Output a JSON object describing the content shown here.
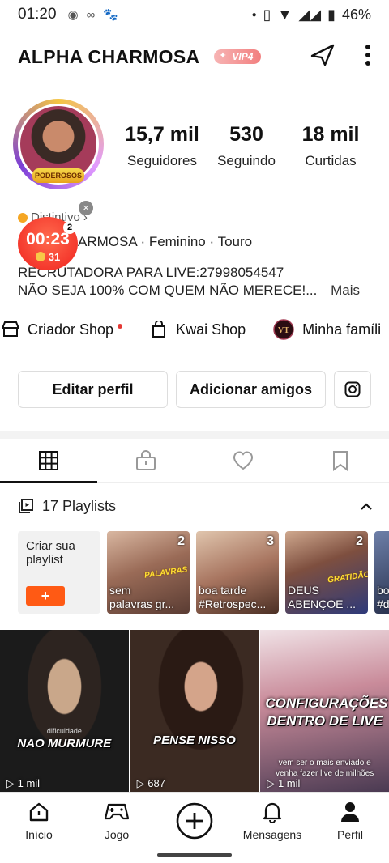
{
  "status_bar": {
    "time": "01:20",
    "battery": "46%"
  },
  "profile": {
    "username": "ALPHA CHARMOSA",
    "vip_badge": "VIP4",
    "avatar_label": "PODEROSOS",
    "stats": [
      {
        "value": "15,7 mil",
        "label": "Seguidores"
      },
      {
        "value": "530",
        "label": "Seguindo"
      },
      {
        "value": "18 mil",
        "label": "Curtidas"
      }
    ],
    "badge_text": "Distintivo",
    "meta_line": "ARMOSA · Feminino · Touro",
    "bio_line1": "RECRUTADORA PARA LIVE:27998054547",
    "bio_line2": "NÃO SEJA 100% COM QUEM NÃO MERECE!...",
    "more_label": "Mais"
  },
  "floating_timer": {
    "time": "00:23",
    "coins": "31",
    "count": "2"
  },
  "shop_links": [
    {
      "label": "Criador Shop",
      "icon": "store-icon"
    },
    {
      "label": "Kwai Shop",
      "icon": "bag-icon"
    },
    {
      "label": "Minha famíli",
      "icon": "family-icon"
    }
  ],
  "buttons": {
    "edit": "Editar perfil",
    "add_friends": "Adicionar amigos"
  },
  "tabs": [
    "grid-icon",
    "lock-bag-icon",
    "heart-icon",
    "bookmark-icon"
  ],
  "playlists": {
    "header": "17 Playlists",
    "create_label": "Criar sua playlist",
    "create_button": "+",
    "items": [
      {
        "count": "2",
        "caption1": "sem",
        "caption2": "palavras gr...",
        "overlay": "PALAVRAS"
      },
      {
        "count": "3",
        "caption1": "boa tarde",
        "caption2": "#Retrospec...",
        "overlay": ""
      },
      {
        "count": "2",
        "caption1": "DEUS",
        "caption2": "ABENÇOE ...",
        "overlay": "GRATIDÃO"
      },
      {
        "count": "",
        "caption1": "bo",
        "caption2": "#d",
        "overlay": ""
      }
    ]
  },
  "videos": [
    {
      "title": "NAO MURMURE",
      "subtitle": "dificuldade",
      "views": "1 mil"
    },
    {
      "title": "PENSE NISSO",
      "subtitle": "",
      "views": "687"
    },
    {
      "title": "CONFIGURAÇÕES DENTRO DE LIVE",
      "subtitle": "vem ser o mais enviado e venha fazer live de milhões",
      "views": "1 mil"
    }
  ],
  "bottom_nav": [
    {
      "label": "Início",
      "icon": "home-icon"
    },
    {
      "label": "Jogo",
      "icon": "gamepad-icon"
    },
    {
      "label": "",
      "icon": "plus-circle-icon"
    },
    {
      "label": "Mensagens",
      "icon": "bell-icon"
    },
    {
      "label": "Perfil",
      "icon": "person-icon"
    }
  ]
}
